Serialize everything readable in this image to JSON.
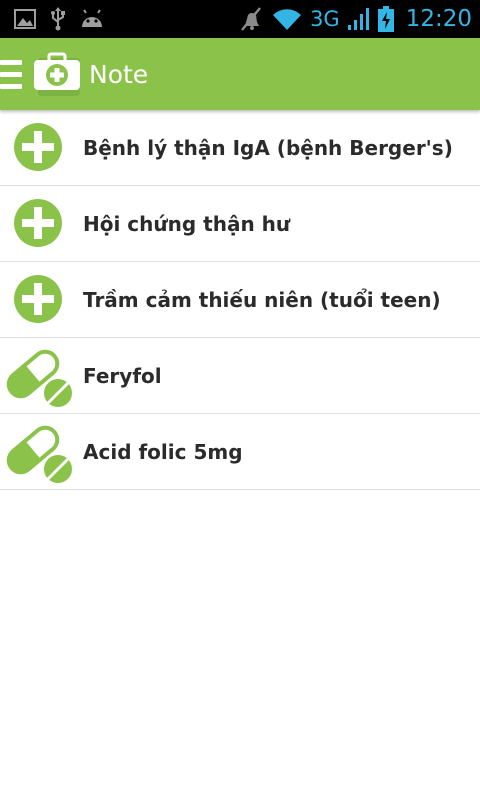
{
  "status_bar": {
    "left_icons": [
      "image-icon",
      "usb-icon",
      "android-icon"
    ],
    "right_icons": [
      "muted-icon",
      "wifi-icon",
      "signal-icon",
      "battery-charging-icon"
    ],
    "network": "3G",
    "time": "12:20"
  },
  "action_bar": {
    "title": "Note",
    "color": "#8bc34a"
  },
  "list": [
    {
      "label": "Bệnh lý thận IgA (bệnh Berger's)",
      "icon": "plus-circle-icon"
    },
    {
      "label": "Hội chứng thận hư",
      "icon": "plus-circle-icon"
    },
    {
      "label": "Trầm cảm thiếu niên (tuổi teen)",
      "icon": "plus-circle-icon"
    },
    {
      "label": "Feryfol",
      "icon": "pill-icon"
    },
    {
      "label": "Acid folic 5mg",
      "icon": "pill-icon"
    }
  ]
}
